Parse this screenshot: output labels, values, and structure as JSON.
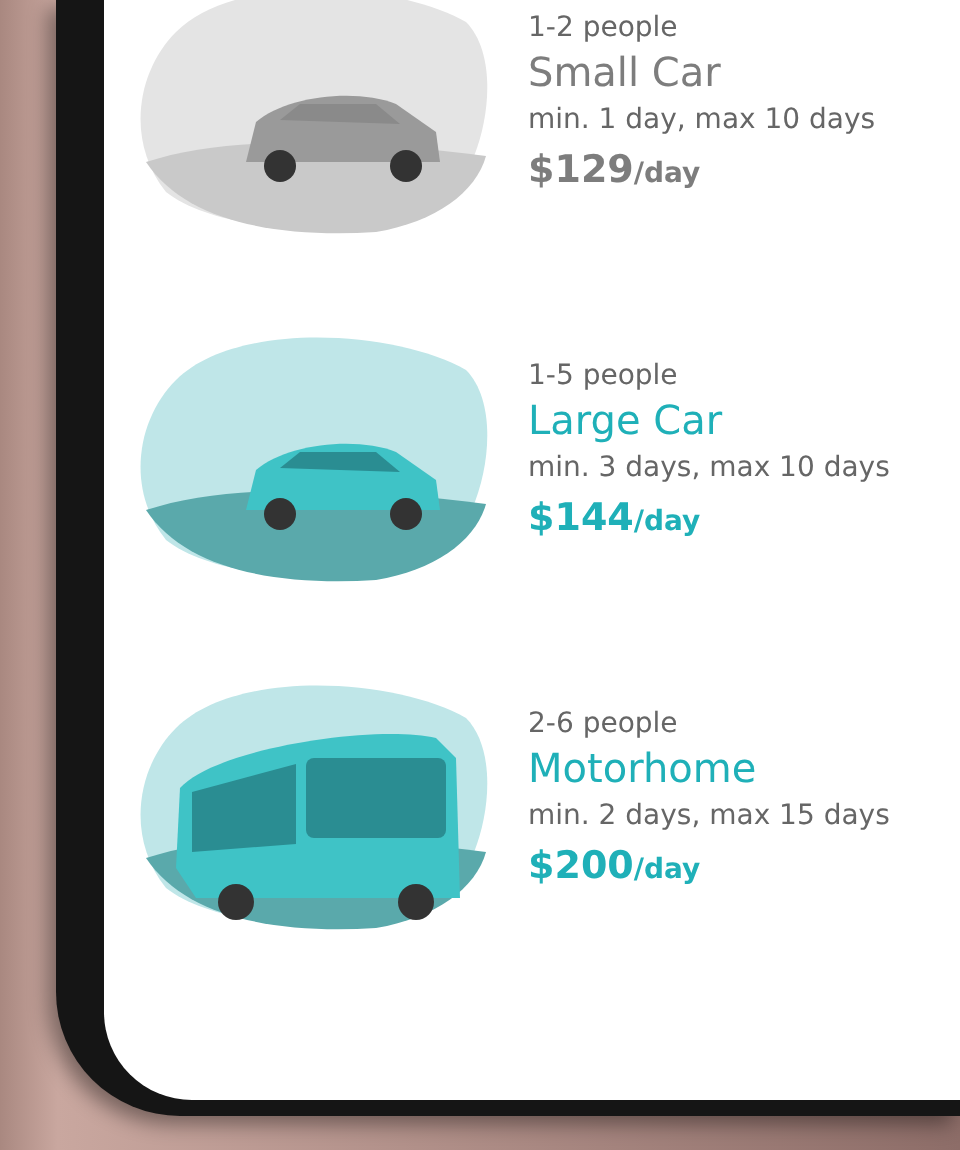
{
  "vehicles": [
    {
      "kind": "car",
      "available": false,
      "capacity": "1-2 people",
      "name": "Small Car",
      "duration": "min. 1 day, max 10 days",
      "price": "$129",
      "unit": "/day"
    },
    {
      "kind": "car",
      "available": true,
      "capacity": "1-5 people",
      "name": "Large Car",
      "duration": "min. 3 days, max 10 days",
      "price": "$144",
      "unit": "/day"
    },
    {
      "kind": "bus",
      "available": true,
      "capacity": "2-6 people",
      "name": "Motorhome",
      "duration": "min. 2 days, max 15 days",
      "price": "$200",
      "unit": "/day"
    }
  ]
}
